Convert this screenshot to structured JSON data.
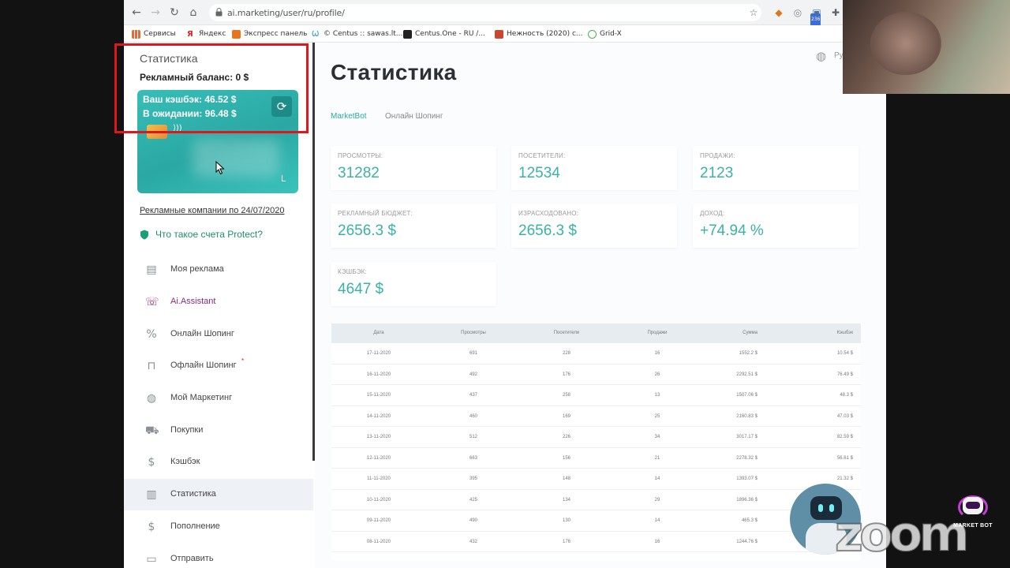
{
  "browser": {
    "url": "ai.marketing/user/ru/profile/",
    "bookmarks": [
      "Сервисы",
      "Яндекс",
      "Экспресс панель",
      "© Centus :: sawas.lt...",
      "Centus.One - RU /...",
      "Нежность (2020) с...",
      "Grid-X"
    ],
    "extension_badge": "236"
  },
  "sidebar": {
    "title": "Статистика",
    "ad_balance": "Рекламный баланс: 0 $",
    "card": {
      "cashback": "Ваш кэшбэк: 46.52 $",
      "pending": "В ожидании: 96.48 $"
    },
    "campaigns_link": "Рекламные компании по 24/07/2020",
    "protect_link": "Что такое счета Protect?",
    "menu": [
      {
        "label": "Моя реклама",
        "icon": "ad-card-icon"
      },
      {
        "label": "Ai.Assistant",
        "icon": "assistant-icon"
      },
      {
        "label": "Онлайн Шопинг",
        "icon": "percent-icon"
      },
      {
        "label": "Офлайн Шопинг",
        "icon": "shopping-bag-icon",
        "badge": "*"
      },
      {
        "label": "Мой Маркетинг",
        "icon": "marketing-icon"
      },
      {
        "label": "Покупки",
        "icon": "cart-icon"
      },
      {
        "label": "Кэшбэк",
        "icon": "dollar-circle-icon"
      },
      {
        "label": "Статистика",
        "icon": "bar-chart-icon",
        "active": true
      },
      {
        "label": "Пополнение",
        "icon": "dollar-icon"
      },
      {
        "label": "Отправить",
        "icon": "send-icon"
      }
    ]
  },
  "main": {
    "title": "Статистика",
    "lang": "Ру",
    "tabs": [
      "MarketBot",
      "Онлайн Шопинг"
    ],
    "stats": [
      {
        "label": "ПРОСМОТРЫ:",
        "value": "31282"
      },
      {
        "label": "ПОСЕТИТЕЛИ:",
        "value": "12534"
      },
      {
        "label": "ПРОДАЖИ:",
        "value": "2123"
      },
      {
        "label": "РЕКЛАМНЫЙ БЮДЖЕТ:",
        "value": "2656.3 $"
      },
      {
        "label": "ИЗРАСХОДОВАНО:",
        "value": "2656.3 $"
      },
      {
        "label": "ДОХОД:",
        "value": "+74.94 %"
      },
      {
        "label": "КЭШБЭК:",
        "value": "4647 $"
      }
    ],
    "table": {
      "columns": [
        "Дата",
        "Просмотры",
        "Посетители",
        "Продажи",
        "Сумма",
        "Кэшбэк"
      ],
      "rows": [
        [
          "17-11-2020",
          "691",
          "228",
          "16",
          "1552.2 $",
          "10.54 $"
        ],
        [
          "16-11-2020",
          "492",
          "176",
          "26",
          "2292.51 $",
          "76.49 $"
        ],
        [
          "15-11-2020",
          "437",
          "258",
          "13",
          "1507.06 $",
          "48.3 $"
        ],
        [
          "14-11-2020",
          "460",
          "169",
          "25",
          "2160.83 $",
          "47.03 $"
        ],
        [
          "13-11-2020",
          "512",
          "226",
          "34",
          "3017.17 $",
          "82.59 $"
        ],
        [
          "12-11-2020",
          "663",
          "156",
          "21",
          "2278.32 $",
          "56.61 $"
        ],
        [
          "11-11-2020",
          "395",
          "148",
          "14",
          "1393.07 $",
          "21.32 $"
        ],
        [
          "10-11-2020",
          "425",
          "134",
          "29",
          "1896.36 $",
          ""
        ],
        [
          "09-11-2020",
          "490",
          "130",
          "14",
          "465.3 $",
          ""
        ],
        [
          "08-11-2020",
          "432",
          "176",
          "16",
          "1244.76 $",
          ""
        ]
      ]
    }
  },
  "overlay": {
    "zoom": "zoom",
    "marketbot_logo": "MARKET BOT"
  }
}
